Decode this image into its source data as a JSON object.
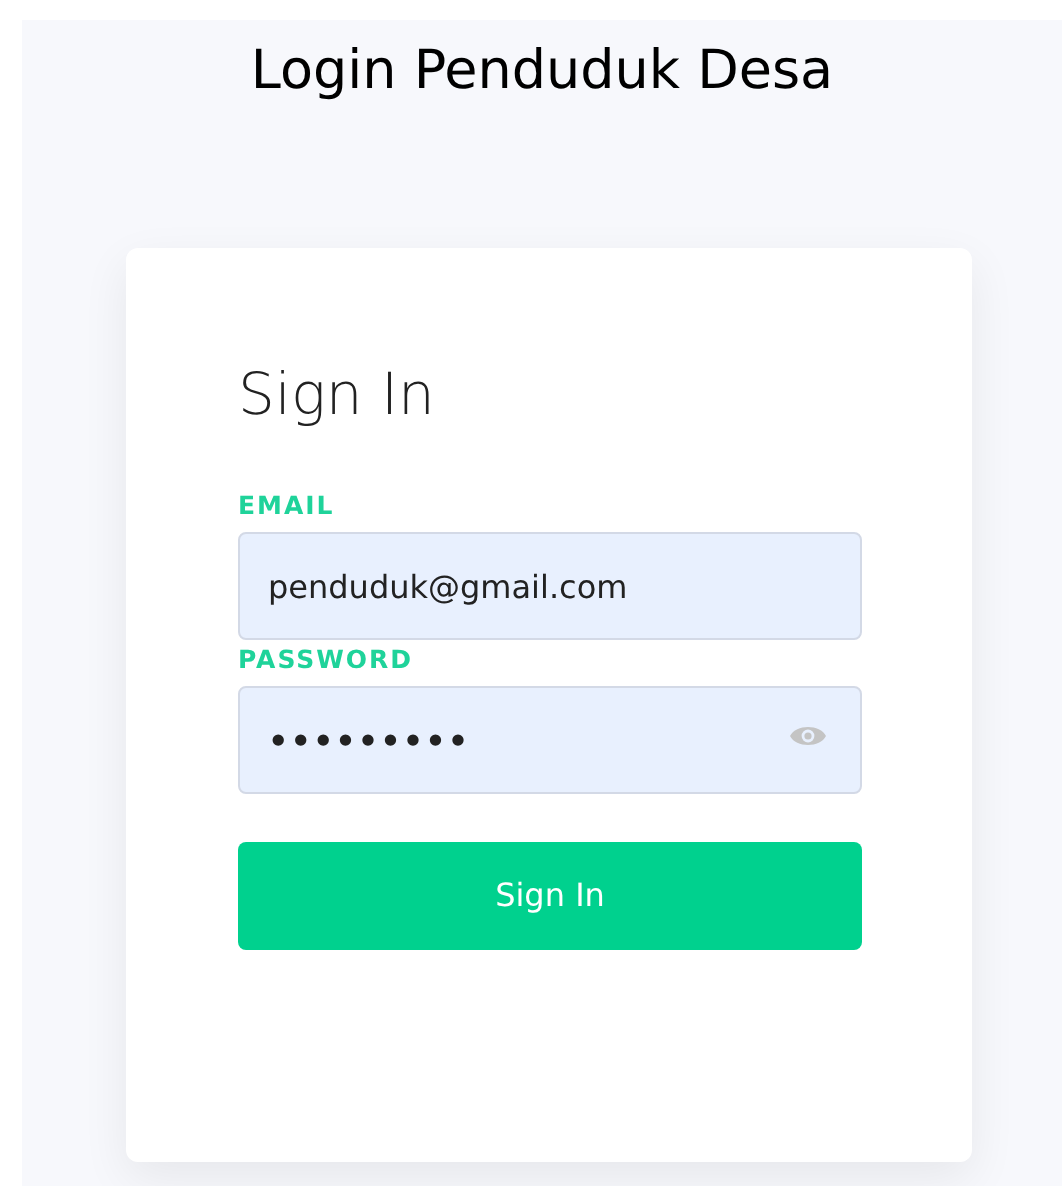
{
  "page_title": "Login Penduduk Desa",
  "card": {
    "heading": "Sign In",
    "fields": [
      {
        "label": "EMAIL",
        "value": "penduduk@gmail.com",
        "kind": "text"
      },
      {
        "label": "PASSWORD",
        "value": "•••••••••",
        "kind": "password"
      }
    ],
    "button": "Sign In"
  }
}
